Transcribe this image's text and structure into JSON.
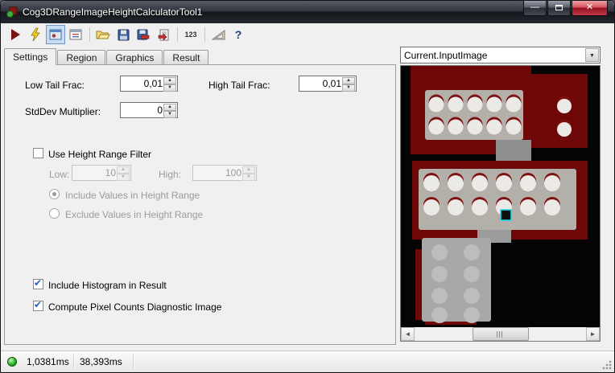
{
  "window": {
    "title": "Cog3DRangeImageHeightCalculatorTool1",
    "minimize_glyph": "—",
    "close_glyph": "✕"
  },
  "toolbar": {
    "items": [
      "run",
      "trigger",
      "display-image-toggle",
      "new-window",
      "open-file",
      "save",
      "save-results",
      "import-results",
      "numeric-precision",
      "measure",
      "help"
    ],
    "numeric_label": "123",
    "help_glyph": "?"
  },
  "tabs": [
    {
      "label": "Settings",
      "active": true
    },
    {
      "label": "Region",
      "active": false
    },
    {
      "label": "Graphics",
      "active": false
    },
    {
      "label": "Result",
      "active": false
    }
  ],
  "settings": {
    "low_tail": {
      "label": "Low Tail Frac:",
      "value": "0,01"
    },
    "high_tail": {
      "label": "High Tail Frac:",
      "value": "0,01"
    },
    "stddev": {
      "label": "StdDev Multiplier:",
      "value": "0"
    },
    "height_filter": {
      "label": "Use Height Range Filter",
      "checked": false,
      "low_label": "Low:",
      "low_value": "10",
      "high_label": "High:",
      "high_value": "100",
      "include_label": "Include Values in Height Range",
      "include_selected": true,
      "exclude_label": "Exclude Values in Height Range",
      "exclude_selected": false
    },
    "include_histogram": {
      "label": "Include Histogram in Result",
      "checked": true
    },
    "compute_pixel": {
      "label": "Compute Pixel Counts Diagnostic Image",
      "checked": true
    }
  },
  "image_panel": {
    "source": "Current.InputImage",
    "dropdown_glyph": "▼"
  },
  "status": {
    "time_primary": "1,0381ms",
    "time_secondary": "38,393ms"
  },
  "colors": {
    "range_background": "#040404",
    "range_red": "#6e0808",
    "plate_gray": "#b3afa9",
    "hole_light": "#eceae6",
    "hole_rim_red": "#7e1212",
    "selection_cyan": "#1fd9e9",
    "status_led_green": "#2fb52f"
  }
}
